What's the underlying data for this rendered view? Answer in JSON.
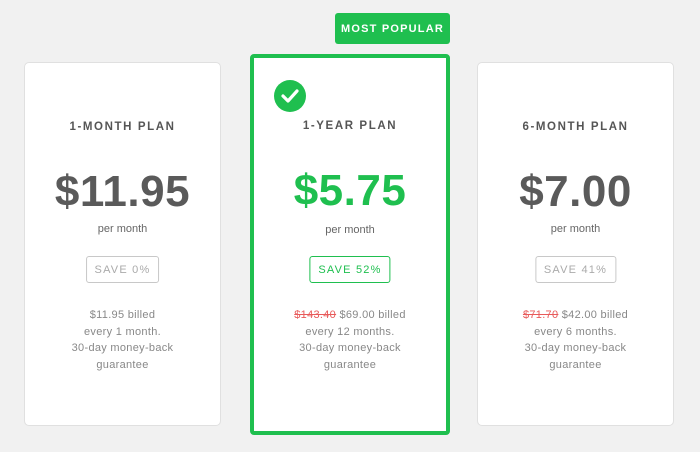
{
  "badge": {
    "label": "MOST POPULAR"
  },
  "plans": [
    {
      "title": "1-MONTH PLAN",
      "price": "$11.95",
      "per": "per month",
      "save": "SAVE 0%",
      "billing": {
        "strike": "",
        "amount": "$11.95 billed",
        "line2": "every 1 month.",
        "line3": "30-day money-back",
        "line4": "guarantee"
      }
    },
    {
      "title": "1-YEAR PLAN",
      "price": "$5.75",
      "per": "per month",
      "save": "SAVE 52%",
      "billing": {
        "strike": "$143.40",
        "amount": "$69.00 billed",
        "line2": "every 12 months.",
        "line3": "30-day money-back",
        "line4": "guarantee"
      }
    },
    {
      "title": "6-MONTH PLAN",
      "price": "$7.00",
      "per": "per month",
      "save": "SAVE 41%",
      "billing": {
        "strike": "$71.70",
        "amount": "$42.00 billed",
        "line2": "every 6 months.",
        "line3": "30-day money-back",
        "line4": "guarantee"
      }
    }
  ],
  "colors": {
    "accent": "#1fbf4f",
    "strike": "#e85a5a",
    "background": "#f1f1f1"
  },
  "icons": {
    "selected": "check-circle-icon"
  }
}
